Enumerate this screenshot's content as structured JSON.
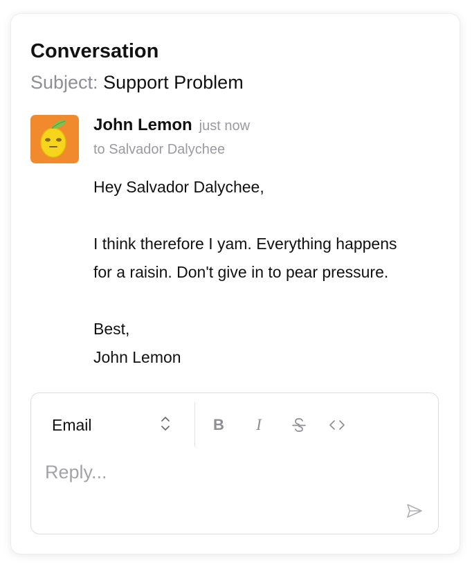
{
  "conversation": {
    "title": "Conversation",
    "subject_label": "Subject:",
    "subject": "Support Problem"
  },
  "message": {
    "sender": "John Lemon",
    "timestamp": "just now",
    "recipient": "to Salvador Dalychee",
    "avatar_icon": "lemon-avatar-icon",
    "body": {
      "greeting": "Hey Salvador Dalychee,",
      "line1": "I think therefore I yam. Everything happens",
      "line2": "for a raisin. Don't give in to pear pressure.",
      "signoff": "Best,",
      "signature": "John Lemon"
    }
  },
  "composer": {
    "channel": "Email",
    "toolbar": [
      "bold-icon",
      "italic-icon",
      "strikethrough-icon",
      "code-icon"
    ],
    "bold_glyph": "B",
    "italic_glyph": "I",
    "placeholder": "Reply...",
    "send_icon": "send-icon"
  },
  "colors": {
    "avatar_bg": "#f08a2c",
    "muted_text": "#8e8e93",
    "border": "#dcdce0"
  }
}
